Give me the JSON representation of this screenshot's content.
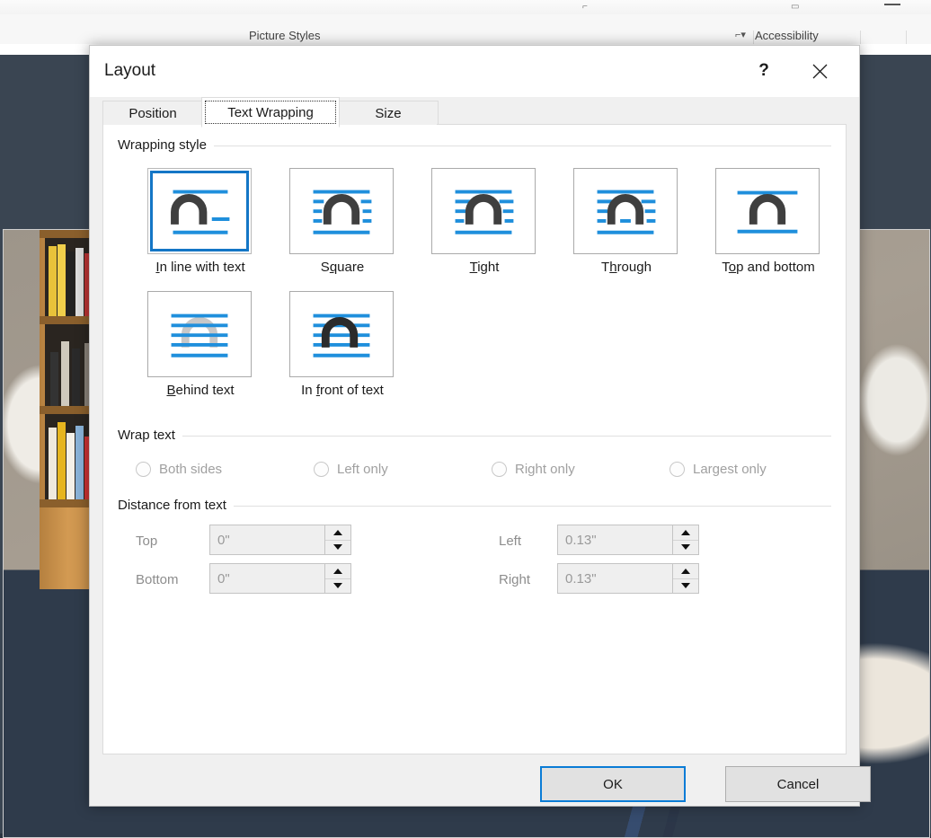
{
  "background": {
    "ribbon": {
      "groups": [
        {
          "label": "Picture Styles"
        },
        {
          "label": "Accessibility"
        }
      ],
      "dialog_launcher_icon": "dialog-box-launcher-icon",
      "minimize_icon": "minimize-icon"
    },
    "photo_alt": "living room photo with bookshelf, lamp, blue sofa and striped pillow"
  },
  "dialog": {
    "title": "Layout",
    "help_label": "?",
    "close_label": "close-icon",
    "tabs": [
      {
        "label": "Position",
        "selected": false
      },
      {
        "label": "Text Wrapping",
        "selected": true
      },
      {
        "label": "Size",
        "selected": false
      }
    ],
    "wrapping_style": {
      "group_label": "Wrapping style",
      "options": [
        {
          "label": "In line with text",
          "accel": "I",
          "accel_index": 0,
          "selected": true,
          "art": "inline"
        },
        {
          "label": "Square",
          "accel": "q",
          "accel_index": 1,
          "selected": false,
          "art": "square"
        },
        {
          "label": "Tight",
          "accel": "T",
          "accel_index": 0,
          "selected": false,
          "art": "tight"
        },
        {
          "label": "Through",
          "accel": "h",
          "accel_index": 1,
          "selected": false,
          "art": "through"
        },
        {
          "label": "Top and bottom",
          "accel": "o",
          "accel_index": 1,
          "selected": false,
          "art": "topbottom"
        },
        {
          "label": "Behind text",
          "accel": "B",
          "accel_index": 0,
          "selected": false,
          "art": "behind"
        },
        {
          "label": "In front of text",
          "accel": "f",
          "accel_index": 3,
          "selected": false,
          "art": "front"
        }
      ]
    },
    "wrap_text": {
      "group_label": "Wrap text",
      "options": [
        {
          "label": "Both sides",
          "selected": false,
          "disabled": true
        },
        {
          "label": "Left only",
          "selected": false,
          "disabled": true
        },
        {
          "label": "Right only",
          "selected": false,
          "disabled": true
        },
        {
          "label": "Largest only",
          "selected": false,
          "disabled": true
        }
      ]
    },
    "distance_from_text": {
      "group_label": "Distance from text",
      "fields": [
        {
          "label": "Top",
          "value": "0\"",
          "disabled": true
        },
        {
          "label": "Bottom",
          "value": "0\"",
          "disabled": true
        },
        {
          "label": "Left",
          "value": "0.13\"",
          "disabled": true
        },
        {
          "label": "Right",
          "value": "0.13\"",
          "disabled": true
        }
      ]
    },
    "buttons": {
      "ok": "OK",
      "cancel": "Cancel"
    }
  },
  "colors": {
    "accent_blue": "#1476c6",
    "focus_blue": "#0a7cd6",
    "icon_line_blue": "#1f8fdc",
    "icon_shape_dark": "#3f3f3f",
    "icon_shape_light": "#c8c8c8",
    "dialog_bg": "#f0f0f0",
    "panel_bg": "#ffffff",
    "disabled_text": "#9a9a9a"
  }
}
